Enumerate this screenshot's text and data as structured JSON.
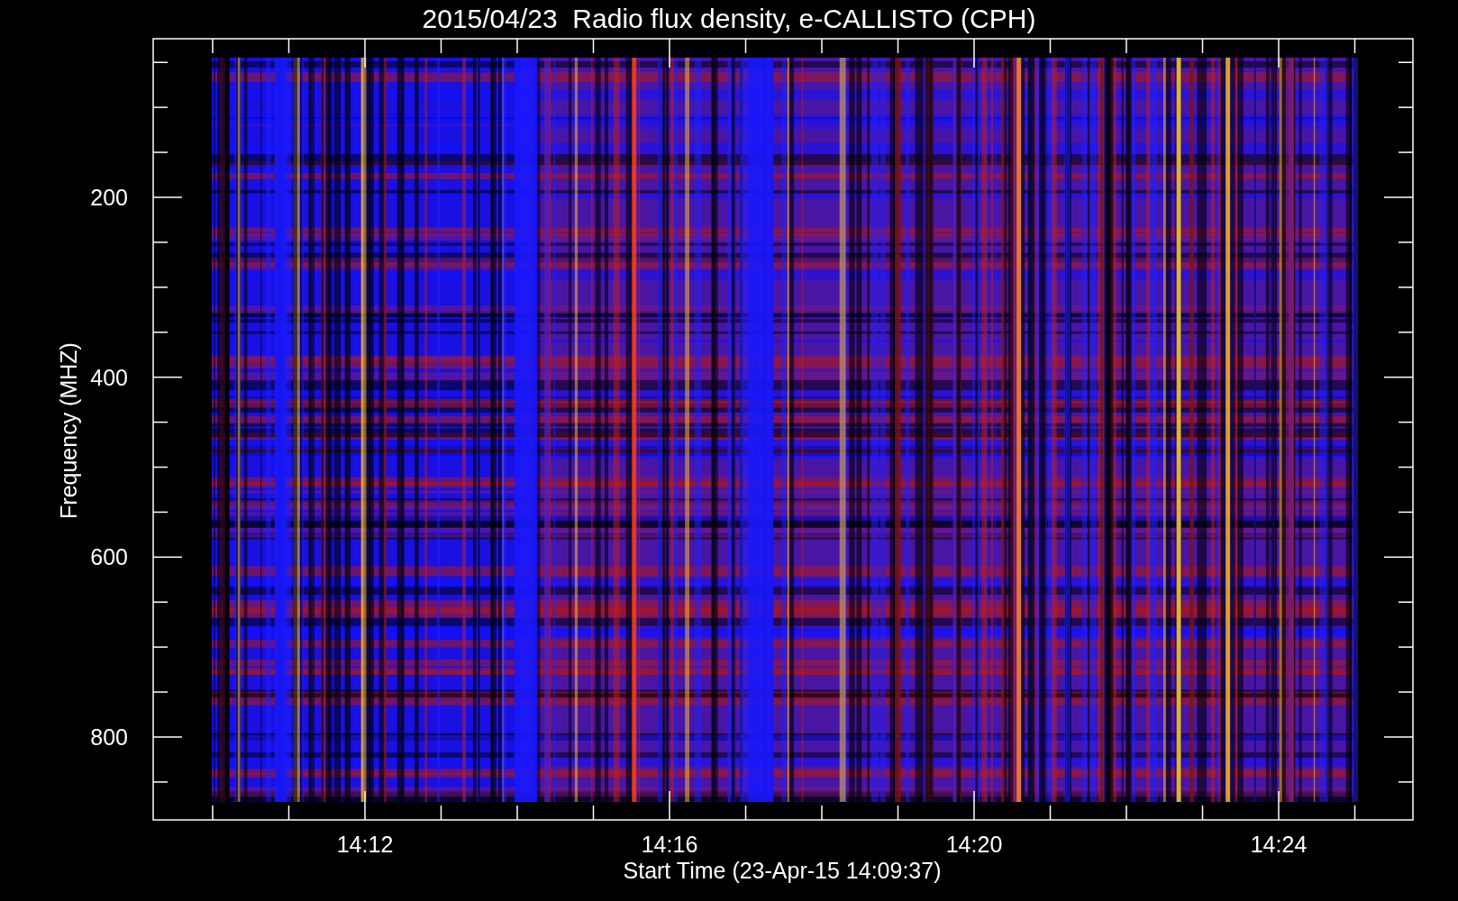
{
  "title": "2015/04/23  Radio flux density, e-CALLISTO (CPH)",
  "plot": {
    "ylabel": "Frequency (MHZ)",
    "xlabel": "Start Time (23-Apr-15 14:09:37)",
    "yticks": [
      "200",
      "400",
      "600",
      "800"
    ],
    "xticks": [
      "14:12",
      "14:16",
      "14:20",
      "14:24"
    ]
  }
}
